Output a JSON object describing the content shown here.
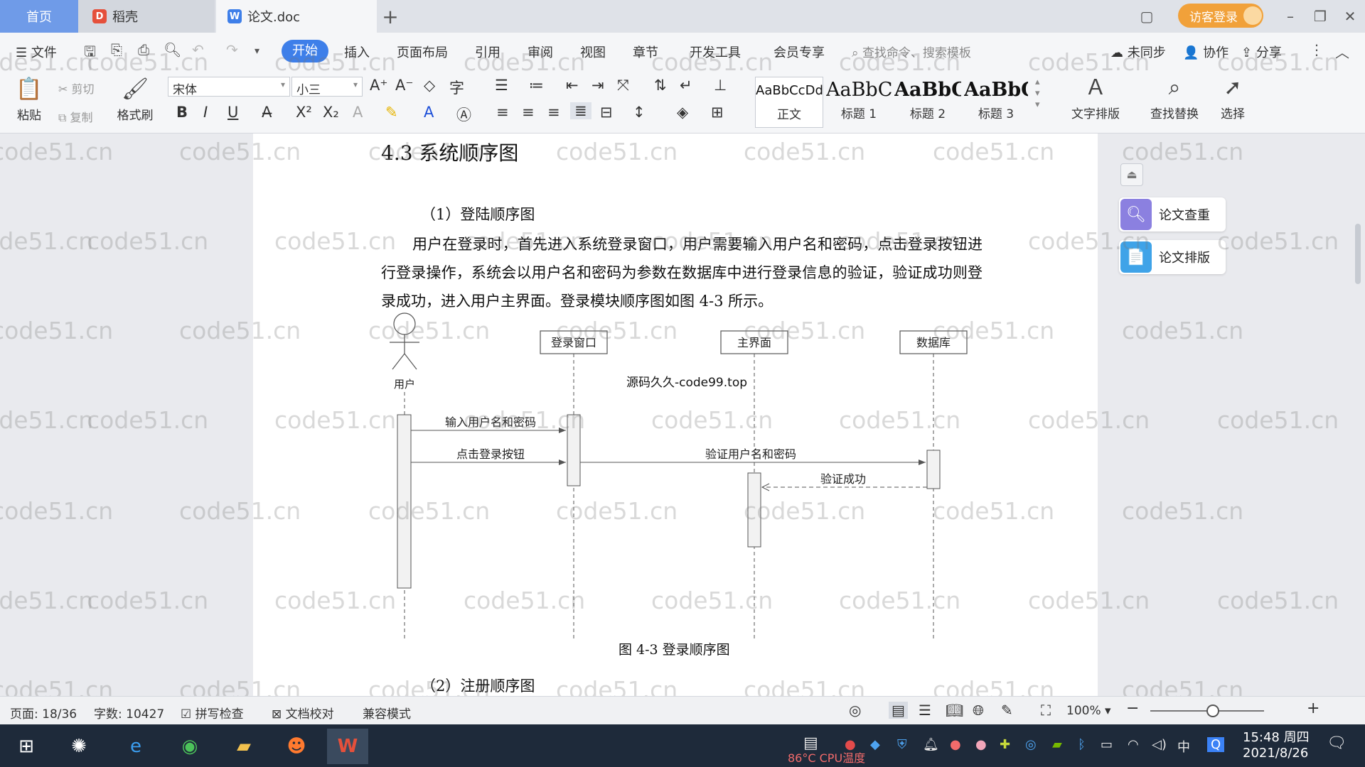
{
  "tabs": {
    "home": "首页",
    "daoke": "稻壳",
    "doc": "论文.doc",
    "add": "+"
  },
  "login_label": "访客登录",
  "menu": {
    "file": "文件",
    "start": "开始",
    "items": [
      "插入",
      "页面布局",
      "引用",
      "审阅",
      "视图",
      "章节",
      "开发工具",
      "会员专享"
    ],
    "search_placeholder": "查找命令、搜索模板",
    "sync": "未同步",
    "collab": "协作",
    "share": "分享"
  },
  "ribbon": {
    "paste": "粘贴",
    "cut": "剪切",
    "copy": "复制",
    "format_painter": "格式刷",
    "font_name": "宋体",
    "font_size": "小三",
    "styles": [
      {
        "preview": "AaBbCcDd",
        "label": "正文"
      },
      {
        "preview": "AaBbC",
        "label": "标题 1"
      },
      {
        "preview": "AaBbC",
        "label": "标题 2"
      },
      {
        "preview": "AaBbC",
        "label": "标题 3"
      }
    ],
    "text_layout": "文字排版",
    "find_replace": "查找替换",
    "select": "选择"
  },
  "document": {
    "heading": "4.3  系统顺序图",
    "sub1": "（1）登陆顺序图",
    "paragraph": "用户在登录时，首先进入系统登录窗口，用户需要输入用户名和密码，点击登录按钮进行登录操作，系统会以用户名和密码为参数在数据库中进行登录信息的验证，验证成功则登录成功，进入用户主界面。登录模块顺序图如图 4-3 所示。",
    "diagram": {
      "actor": "用户",
      "lifelines": [
        "登录窗口",
        "主界面",
        "数据库"
      ],
      "source_mark": "源码久久-code99.top",
      "messages": [
        "输入用户名和密码",
        "点击登录按钮",
        "验证用户名和密码",
        "验证成功"
      ]
    },
    "caption": "图 4-3  登录顺序图",
    "sub2": "（2）注册顺序图"
  },
  "side_panel": {
    "check": "论文查重",
    "layout": "论文排版"
  },
  "watermark": "code51.cn",
  "status": {
    "page": "页面: 18/36",
    "words": "字数: 10427",
    "spell": "拼写检查",
    "proof": "文档校对",
    "compat": "兼容模式",
    "zoom": "100%",
    "zoom_level": 0.55
  },
  "taskbar": {
    "time": "15:48 周四",
    "date": "2021/8/26",
    "cpu_label": "CPU温度",
    "cpu_temp": "86°C",
    "ime": "中"
  },
  "colors": {
    "accent": "#3e7fe9",
    "home_tab": "#6f9be8",
    "login": "#f1a13a",
    "taskbar": "#1e2a3a",
    "check_btn": "#8b80e0",
    "layout_btn": "#3fa3e8"
  }
}
